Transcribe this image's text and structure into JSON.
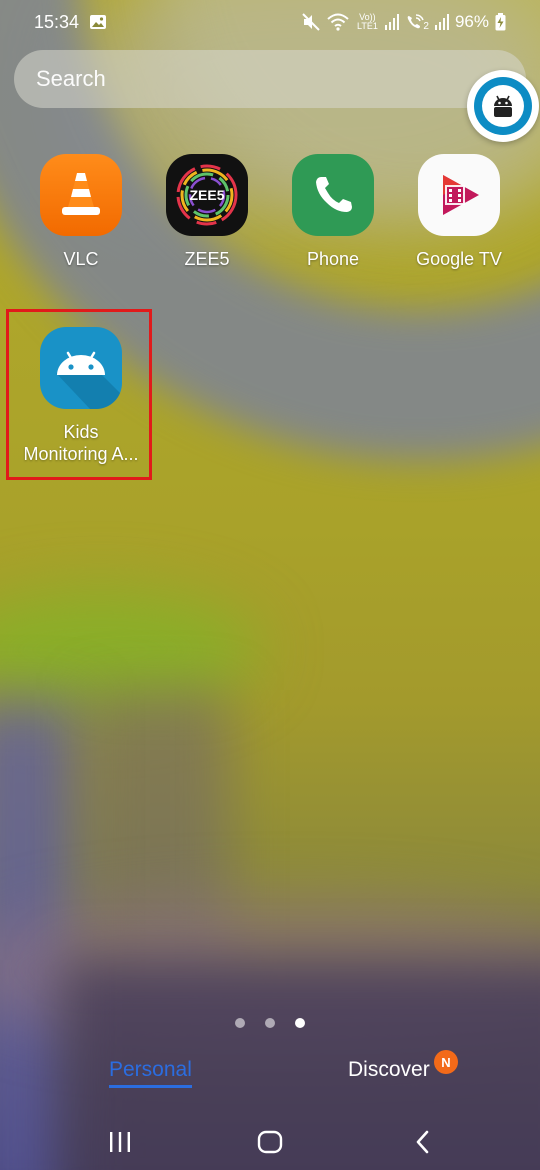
{
  "status_bar": {
    "time": "15:34",
    "network_volte": "Vo)) LTE1",
    "sim2": "2",
    "battery": "96%",
    "icons": [
      "image-notification-icon",
      "mute-icon",
      "wifi-icon",
      "volte-icon",
      "signal-icon",
      "wifi-calling-icon",
      "signal-icon",
      "battery-charging-icon"
    ]
  },
  "search": {
    "placeholder": "Search"
  },
  "floating_bubble": {
    "icon": "android-robot-icon",
    "color": "#0d8cc4"
  },
  "apps": [
    {
      "label": "VLC",
      "icon": "vlc-cone-icon"
    },
    {
      "label": "ZEE5",
      "icon": "zee5-icon"
    },
    {
      "label": "Phone",
      "icon": "phone-icon"
    },
    {
      "label": "Google TV",
      "icon": "google-tv-icon"
    },
    {
      "label_line1": "Kids",
      "label_line2": "Monitoring A...",
      "icon": "android-robot-icon",
      "highlighted": true,
      "highlight_color": "#e11a1a"
    }
  ],
  "page_indicator": {
    "count": 3,
    "active": 3
  },
  "tabs": {
    "personal": "Personal",
    "discover": "Discover",
    "discover_badge": "N",
    "active": "Personal",
    "accent": "#2b6de0",
    "badge_color": "#f36a19"
  },
  "nav": {
    "recent": "recent-apps-icon",
    "home": "home-icon",
    "back": "back-icon"
  }
}
